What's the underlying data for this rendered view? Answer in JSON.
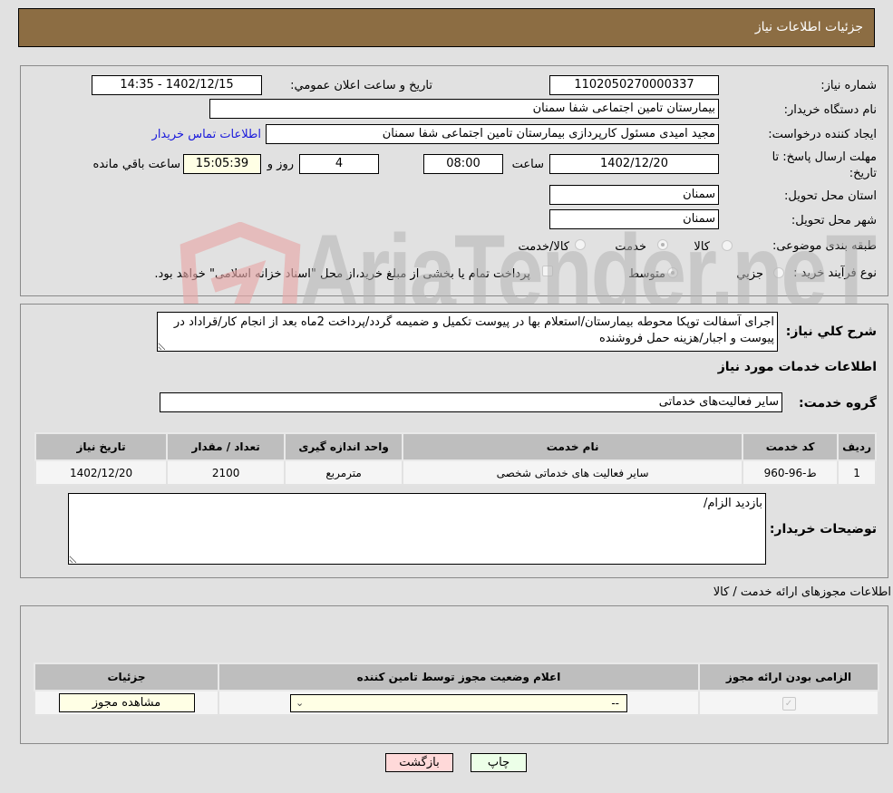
{
  "header": {
    "title": "جزئیات اطلاعات نیاز"
  },
  "form": {
    "need_number_label": "شماره نیاز:",
    "need_number": "1102050270000337",
    "announce_label": "تاریخ و ساعت اعلان عمومي:",
    "announce_value": "1402/12/15 - 14:35",
    "buyer_org_label": "نام دستگاه خریدار:",
    "buyer_org": "بیمارستان تامین اجتماعی شفا سمنان",
    "creator_label": "ایجاد کننده درخواست:",
    "creator": "مجید امیدی مسئول کارپردازی بیمارستان تامین اجتماعی شفا سمنان",
    "contact_link": "اطلاعات تماس خریدار",
    "deadline_label_1": "مهلت ارسال پاسخ: تا",
    "deadline_label_2": "تاریخ:",
    "deadline_date": "1402/12/20",
    "time_label": "ساعت",
    "deadline_time": "08:00",
    "days_value": "4",
    "days_label": "روز و",
    "remaining_time": "15:05:39",
    "remaining_label": "ساعت باقي مانده",
    "province_label": "استان محل تحویل:",
    "province": "سمنان",
    "city_label": "شهر محل تحویل:",
    "city": "سمنان",
    "category_label": "طبقه بندی موضوعی:",
    "category_options": [
      "کالا",
      "خدمت",
      "کالا/خدمت"
    ],
    "category_selected": "خدمت",
    "process_label": "نوع فرآیند خرید :",
    "process_options": [
      "جزيي",
      "متوسط"
    ],
    "process_selected": "متوسط",
    "treasury_note": "پرداخت تمام یا بخشی از مبلغ خرید،از محل \"اسناد خزانه اسلامی\" خواهد بود."
  },
  "description": {
    "label": "شرح کلي نیاز:",
    "text": "اجرای آسفالت توپکا محوطه بیمارستان/استعلام بها در پیوست تکمیل و ضمیمه گردد/پرداخت 2ماه بعد از انجام کار/قراداد در پیوست و اجبار/هزینه حمل فروشنده"
  },
  "services": {
    "section_title": "اطلاعات خدمات مورد نیاز",
    "group_label": "گروه خدمت:",
    "group_value": "سایر فعالیت‌های خدماتی",
    "columns": [
      "ردیف",
      "کد خدمت",
      "نام خدمت",
      "واحد اندازه گیری",
      "تعداد / مقدار",
      "تاریخ نیاز"
    ],
    "rows": [
      [
        "1",
        "ط-96-960",
        "سایر فعالیت های خدماتی شخصی",
        "مترمربع",
        "2100",
        "1402/12/20"
      ]
    ]
  },
  "buyer_notes": {
    "label": "توضیحات خریدار:",
    "text": "بازدید الزام/"
  },
  "permits": {
    "section_title": "اطلاعات مجوزهای ارائه خدمت / کالا",
    "columns": [
      "الزامی بودن ارائه مجوز",
      "اعلام وضعیت مجوز توسط تامین کننده",
      "جزئیات"
    ],
    "row": {
      "required_checked": true,
      "status_select": "--",
      "view_button": "مشاهده مجوز"
    }
  },
  "buttons": {
    "back": "بازگشت",
    "print": "چاپ"
  },
  "watermark": {
    "text": "AriaTender.neT"
  }
}
